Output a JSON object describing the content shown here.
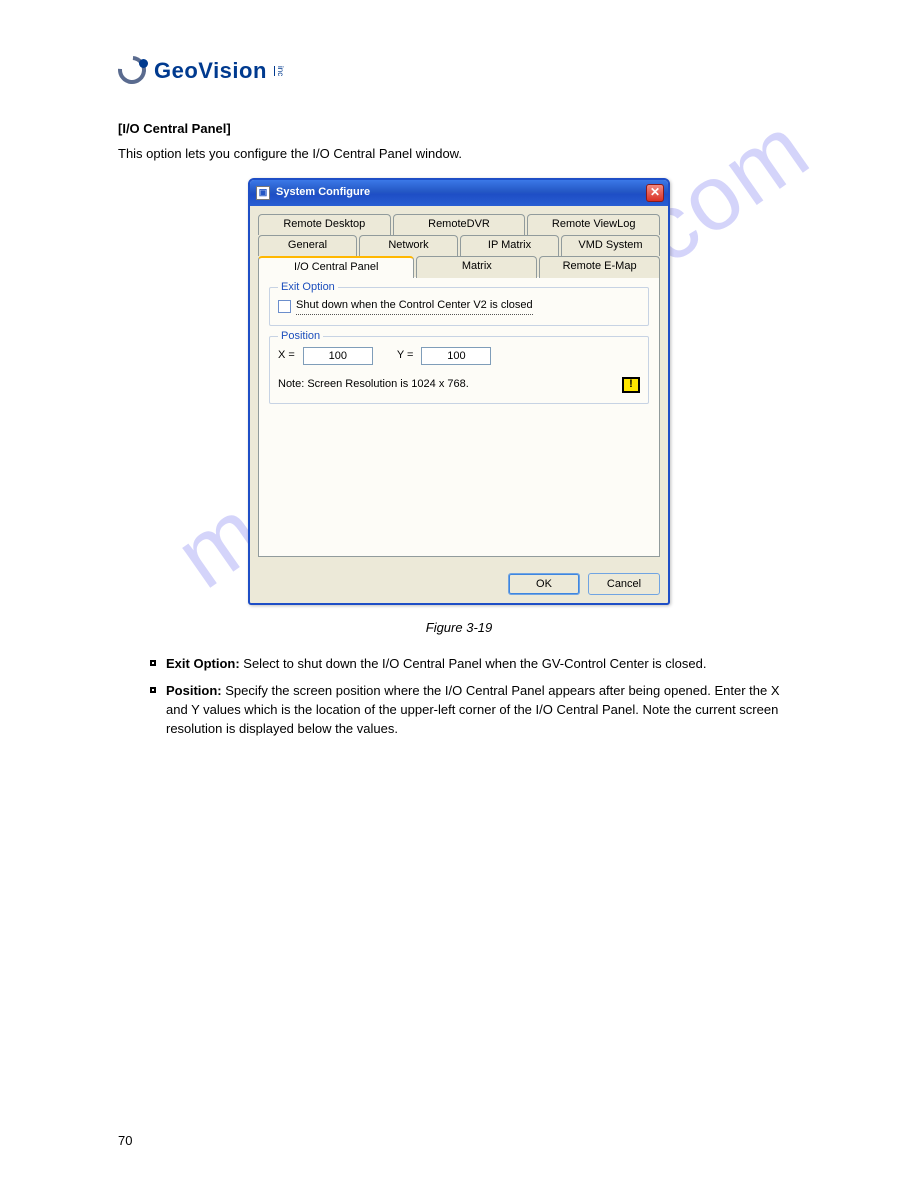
{
  "logo": {
    "text": "GeoVision",
    "inc": "inc"
  },
  "heading": "[I/O Central Panel]",
  "para": "This option lets you configure the I/O Central Panel window.",
  "dialog": {
    "title": "System Configure",
    "tabs_row1": [
      "Remote Desktop",
      "RemoteDVR",
      "Remote ViewLog"
    ],
    "tabs_row2": [
      "General",
      "Network",
      "IP Matrix",
      "VMD System"
    ],
    "tabs_row3": [
      "I/O Central Panel",
      "Matrix",
      "Remote E-Map"
    ],
    "exitoption": {
      "legend": "Exit Option",
      "checkbox_label": "Shut down when the Control Center V2 is closed"
    },
    "position": {
      "legend": "Position",
      "x_label": "X =",
      "x_value": "100",
      "y_label": "Y =",
      "y_value": "100",
      "note": "Note: Screen Resolution is 1024 x 768."
    },
    "ok_label": "OK",
    "cancel_label": "Cancel"
  },
  "figure_caption": "Figure 3-19",
  "bullets": {
    "b1_bold": "Exit Option:",
    "b1_rest": " Select to shut down the I/O Central Panel when the GV-Control Center is closed.",
    "b2_bold": "Position:",
    "b2_rest": " Specify the screen position where the I/O Central Panel appears after being opened. Enter the X and Y values which is the location of the upper-left corner of the I/O Central Panel. Note the current screen resolution is displayed below the values."
  },
  "watermark": "manualshive.com",
  "page_number": "70"
}
